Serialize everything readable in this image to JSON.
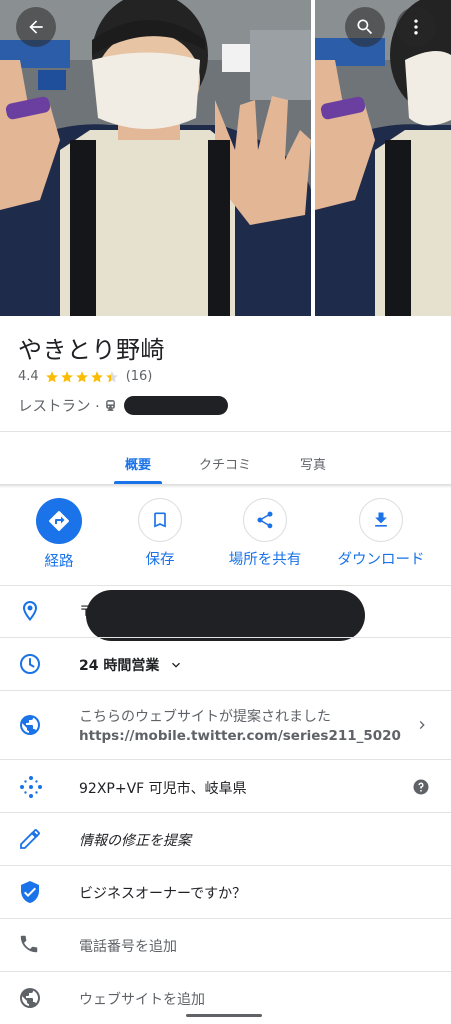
{
  "place": {
    "name": "やきとり野崎",
    "rating": "4.4",
    "rating_stars": 4.4,
    "review_count": "(16)",
    "category": "レストラン ·"
  },
  "tabs": [
    {
      "label": "概要",
      "active": true
    },
    {
      "label": "クチコミ",
      "active": false
    },
    {
      "label": "写真",
      "active": false
    }
  ],
  "actions": [
    {
      "label": "経路",
      "icon": "directions-icon"
    },
    {
      "label": "保存",
      "icon": "bookmark-icon"
    },
    {
      "label": "場所を共有",
      "icon": "share-icon"
    },
    {
      "label": "ダウンロード",
      "icon": "download-icon"
    }
  ],
  "info": {
    "address_prefix": "〒",
    "hours": "24 時間営業",
    "website_suggest": "こちらのウェブサイトが提案されました",
    "website_url": "https://mobile.twitter.com/series211_5020",
    "plus_code": "92XP+VF 可児市、岐阜県",
    "suggest_edit": "情報の修正を提案",
    "owner": "ビジネスオーナーですか？",
    "add_phone": "電話番号を追加",
    "add_website": "ウェブサイトを追加"
  },
  "colors": {
    "accent": "#1a73e8",
    "star": "#fbbc04",
    "text": "#202124",
    "muted": "#5f6368"
  }
}
